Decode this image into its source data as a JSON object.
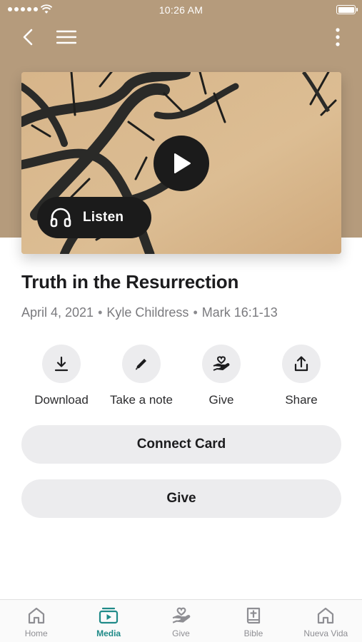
{
  "status_bar": {
    "time": "10:26 AM"
  },
  "hero": {
    "listen_label": "Listen"
  },
  "sermon": {
    "title": "Truth in the Resurrection",
    "date": "April 4, 2021",
    "speaker": "Kyle Childress",
    "passage": "Mark 16:1-13",
    "separator": "•"
  },
  "actions": [
    {
      "label": "Download",
      "icon": "download-icon"
    },
    {
      "label": "Take a note",
      "icon": "pencil-icon"
    },
    {
      "label": "Give",
      "icon": "hand-heart-icon"
    },
    {
      "label": "Share",
      "icon": "share-icon"
    }
  ],
  "buttons": {
    "connect_card": "Connect Card",
    "give": "Give"
  },
  "tabbar": {
    "active": "Media",
    "tabs": [
      {
        "label": "Home",
        "icon": "home-icon"
      },
      {
        "label": "Media",
        "icon": "media-icon"
      },
      {
        "label": "Give",
        "icon": "hand-heart-icon"
      },
      {
        "label": "Bible",
        "icon": "bible-icon"
      },
      {
        "label": "Nueva Vida",
        "icon": "home-icon"
      }
    ]
  },
  "colors": {
    "header": "#b59b7c",
    "accent": "#1f8a88",
    "button_bg": "#ececee",
    "dark": "#1b1b1b"
  }
}
